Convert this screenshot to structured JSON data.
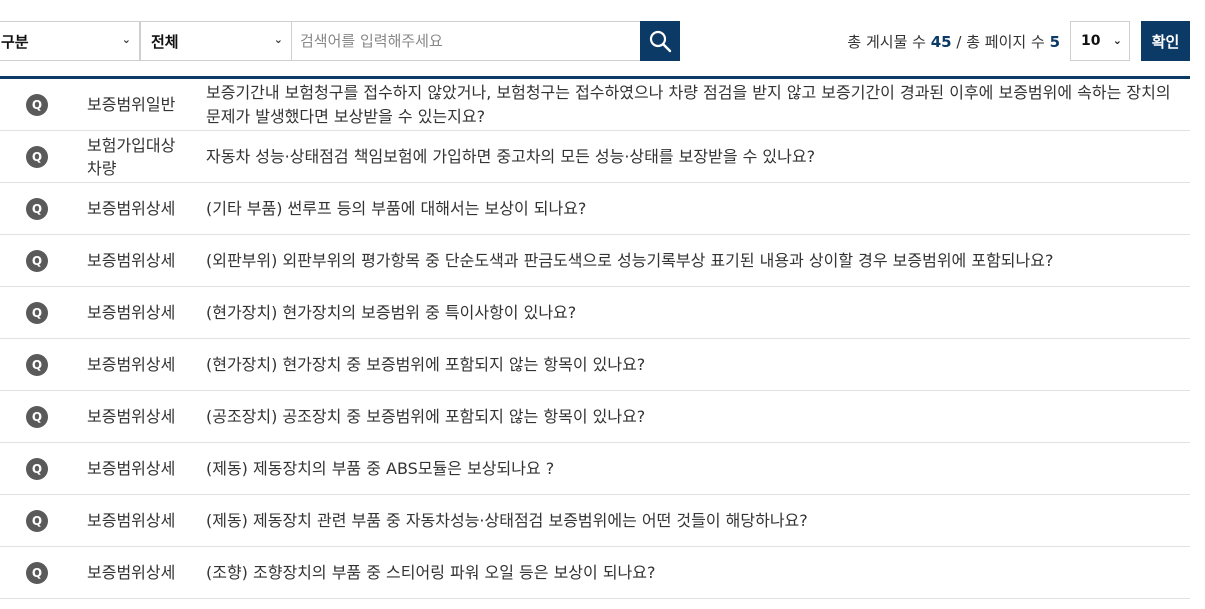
{
  "filters": {
    "category_label": "구분",
    "scope_label": "전체",
    "search_placeholder": "검색어를 입력해주세요",
    "total_posts_label": "총 게시물 수",
    "total_posts": "45",
    "separator": "/",
    "total_pages_label": "총 페이지 수",
    "total_pages": "5",
    "per_page": "10",
    "confirm_label": "확인"
  },
  "faq": {
    "q_badge": "Q",
    "items": [
      {
        "category": "보증범위일반",
        "question": "보증기간내 보험청구를 접수하지 않았거나, 보험청구는 접수하였으나 차량 점검을 받지 않고 보증기간이 경과된 이후에 보증범위에 속하는 장치의 문제가 발생했다면 보상받을 수 있는지요?"
      },
      {
        "category": "보험가입대상차량",
        "question": "자동차 성능·상태점검 책임보험에 가입하면 중고차의 모든 성능·상태를 보장받을 수 있나요?"
      },
      {
        "category": "보증범위상세",
        "question": "(기타 부품) 썬루프 등의 부품에 대해서는 보상이 되나요?"
      },
      {
        "category": "보증범위상세",
        "question": "(외판부위) 외판부위의 평가항목 중 단순도색과 판금도색으로 성능기록부상 표기된 내용과 상이할 경우 보증범위에 포함되나요?"
      },
      {
        "category": "보증범위상세",
        "question": "(현가장치) 현가장치의 보증범위 중 특이사항이 있나요?"
      },
      {
        "category": "보증범위상세",
        "question": "(현가장치) 현가장치 중 보증범위에 포함되지 않는 항목이 있나요?"
      },
      {
        "category": "보증범위상세",
        "question": "(공조장치) 공조장치 중 보증범위에 포함되지 않는 항목이 있나요?"
      },
      {
        "category": "보증범위상세",
        "question": "(제동) 제동장치의 부품 중 ABS모듈은 보상되나요 ?"
      },
      {
        "category": "보증범위상세",
        "question": "(제동) 제동장치 관련 부품 중 자동차성능·상태점검 보증범위에는 어떤 것들이 해당하나요?"
      },
      {
        "category": "보증범위상세",
        "question": "(조향) 조향장치의 부품 중 스티어링 파워 오일 등은 보상이 되나요?"
      }
    ]
  },
  "icons": {
    "search": "search-icon",
    "caret": "chevron-down-icon",
    "question": "q-badge-icon"
  },
  "colors": {
    "accent": "#0c3a66",
    "badge": "#5a5a5a"
  }
}
